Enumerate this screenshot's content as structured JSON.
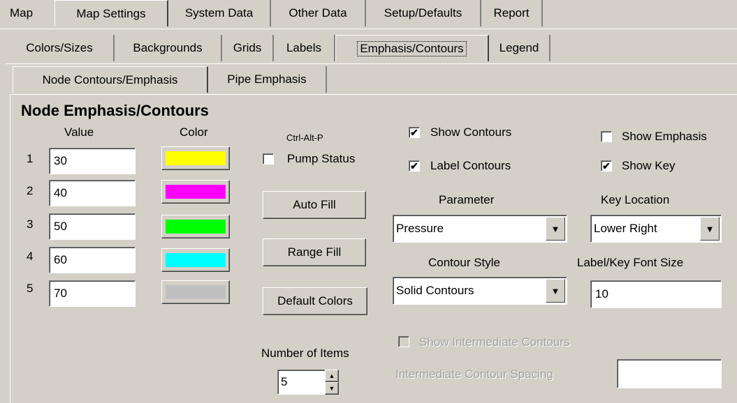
{
  "top_tabs": [
    "Map",
    "Map Settings",
    "System Data",
    "Other Data",
    "Setup/Defaults",
    "Report"
  ],
  "sub_tabs": [
    "Colors/Sizes",
    "Backgrounds",
    "Grids",
    "Labels",
    "Emphasis/Contours",
    "Legend"
  ],
  "inner_tabs": [
    "Node Contours/Emphasis",
    "Pipe Emphasis"
  ],
  "section_title": "Node Emphasis/Contours",
  "columns": {
    "value": "Value",
    "color": "Color"
  },
  "rows": [
    {
      "index": "1",
      "value": "30",
      "color": "#ffff00"
    },
    {
      "index": "2",
      "value": "40",
      "color": "#ff00ff"
    },
    {
      "index": "3",
      "value": "50",
      "color": "#00ff00"
    },
    {
      "index": "4",
      "value": "60",
      "color": "#00ffff"
    },
    {
      "index": "5",
      "value": "70",
      "color": "#c0c0c0"
    }
  ],
  "pump": {
    "shortcut": "Ctrl-Alt-P",
    "label": "Pump Status",
    "checked": false
  },
  "buttons": {
    "auto_fill": "Auto Fill",
    "range_fill": "Range Fill",
    "default_colors": "Default Colors"
  },
  "number_of_items": {
    "label": "Number of Items",
    "value": "5"
  },
  "show_contours": {
    "label": "Show Contours",
    "checked": true
  },
  "label_contours": {
    "label": "Label Contours",
    "checked": true
  },
  "show_emphasis": {
    "label": "Show Emphasis",
    "checked": false
  },
  "show_key": {
    "label": "Show Key",
    "checked": true
  },
  "parameter": {
    "label": "Parameter",
    "value": "Pressure"
  },
  "key_location": {
    "label": "Key Location",
    "value": "Lower Right"
  },
  "contour_style": {
    "label": "Contour Style",
    "value": "Solid Contours"
  },
  "font_size": {
    "label": "Label/Key Font Size",
    "value": "10"
  },
  "intermediate": {
    "show_label": "Show Intermediate Contours",
    "spacing_label": "Intermediate Contour Spacing",
    "spacing_value": ""
  },
  "colors": {
    "face": "#d4d0c8",
    "field": "#ffffff",
    "disabled_text": "#a0a0a0"
  },
  "icons": {
    "check": "✔",
    "dropdown": "▼",
    "spin_up": "▲",
    "spin_down": "▼"
  }
}
